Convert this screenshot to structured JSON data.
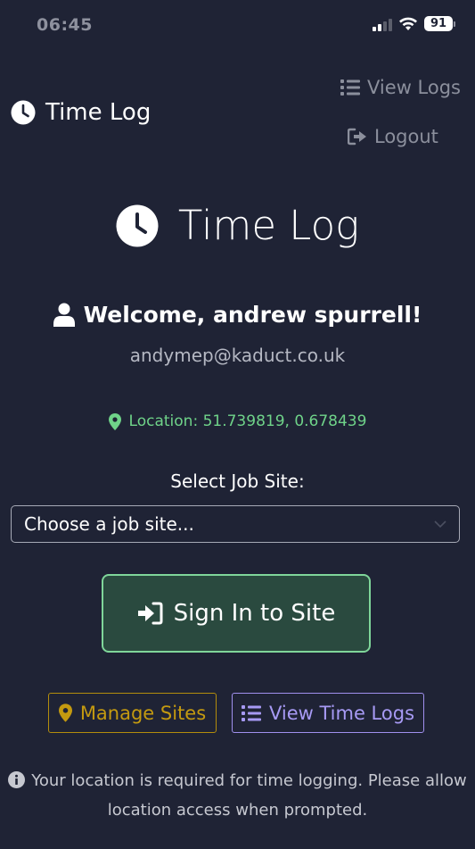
{
  "status_bar": {
    "time": "06:45",
    "battery": "91"
  },
  "nav": {
    "brand": "Time Log",
    "view_logs": "View Logs",
    "logout": "Logout"
  },
  "hero": {
    "title": "Time Log"
  },
  "user": {
    "welcome": "Welcome, andrew spurrell!",
    "email": "andymep@kaduct.co.uk"
  },
  "location": {
    "text": "Location: 51.739819, 0.678439"
  },
  "job_site": {
    "label": "Select Job Site:",
    "selected": "Choose a job site..."
  },
  "actions": {
    "sign_in": "Sign In to Site",
    "manage_sites": "Manage Sites",
    "view_time_logs": "View Time Logs"
  },
  "note": {
    "line1": "Your location is required for time logging. Please allow",
    "line2": "location access when prompted."
  },
  "colors": {
    "background": "#1f2335",
    "success": "#6fd389",
    "warning": "#c49a10",
    "accent": "#a79af4"
  },
  "icons": [
    "clock-icon",
    "list-icon",
    "logout-icon",
    "user-icon",
    "map-marker-icon",
    "chevron-down-icon",
    "sign-in-icon",
    "info-icon",
    "signal-icon",
    "wifi-icon",
    "battery-icon"
  ]
}
